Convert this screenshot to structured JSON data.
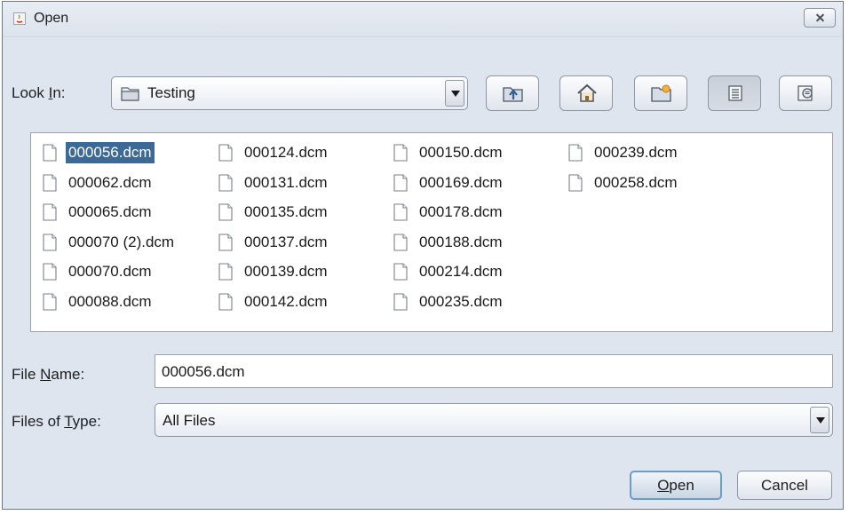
{
  "window": {
    "title": "Open",
    "title_icon": "java-icon",
    "close_icon": "close-icon"
  },
  "look_in": {
    "label_pre": "Look ",
    "label_mnemonic": "I",
    "label_post": "n:",
    "value": "Testing",
    "folder_icon": "folder-icon"
  },
  "toolbar": {
    "buttons": [
      {
        "name": "up-one-level-button",
        "icon": "folder-up-icon"
      },
      {
        "name": "home-button",
        "icon": "home-icon"
      },
      {
        "name": "new-folder-button",
        "icon": "new-folder-icon"
      },
      {
        "name": "list-view-button",
        "icon": "list-view-icon",
        "pressed": true
      },
      {
        "name": "details-view-button",
        "icon": "details-view-icon"
      }
    ]
  },
  "files": {
    "columns": [
      [
        "000056.dcm",
        "000062.dcm",
        "000065.dcm",
        "000070 (2).dcm",
        "000070.dcm",
        "000088.dcm"
      ],
      [
        "000124.dcm",
        "000131.dcm",
        "000135.dcm",
        "000137.dcm",
        "000139.dcm",
        "000142.dcm"
      ],
      [
        "000150.dcm",
        "000169.dcm",
        "000178.dcm",
        "000188.dcm",
        "000214.dcm",
        "000235.dcm"
      ],
      [
        "000239.dcm",
        "000258.dcm"
      ]
    ],
    "selected": "000056.dcm"
  },
  "file_name": {
    "label_pre": "File ",
    "label_mnemonic": "N",
    "label_post": "ame:",
    "value": "000056.dcm"
  },
  "files_of_type": {
    "label_pre": "Files of ",
    "label_mnemonic": "T",
    "label_post": "ype:",
    "value": "All Files"
  },
  "actions": {
    "open_mnemonic": "O",
    "open_rest": "pen",
    "cancel": "Cancel"
  },
  "colors": {
    "selection": "#3b6a96",
    "background": "#dfe5ef",
    "default_button_border": "#6e9cc8"
  }
}
